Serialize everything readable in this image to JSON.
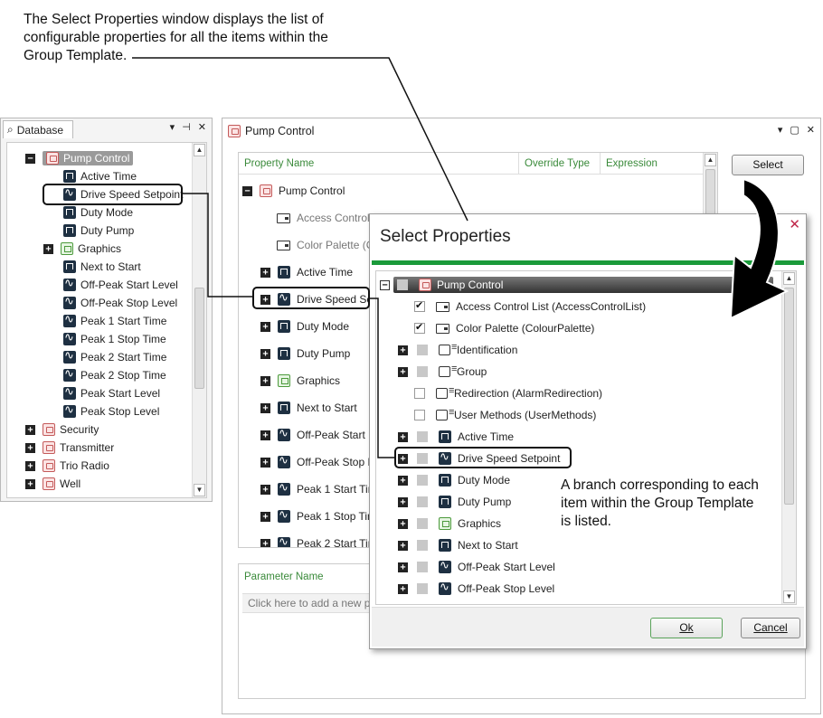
{
  "callouts": {
    "top": [
      "The Select Properties window displays the list of",
      "configurable properties for all the items within the",
      "Group Template."
    ],
    "branch": [
      "A branch corresponding to each",
      "item within the Group Template",
      "is listed."
    ]
  },
  "database_panel": {
    "tab_label": "Database",
    "controls": [
      "▾",
      "⊣",
      "✕"
    ],
    "tree": [
      {
        "label": "Pump Control",
        "icon": "folder",
        "level": 0,
        "expanded": true,
        "selected": true
      },
      {
        "label": "Active Time",
        "icon": "digital",
        "level": 1
      },
      {
        "label": "Drive Speed Setpoint",
        "icon": "analog",
        "level": 1
      },
      {
        "label": "Duty Mode",
        "icon": "digital",
        "level": 1
      },
      {
        "label": "Duty Pump",
        "icon": "digital",
        "level": 1
      },
      {
        "label": "Graphics",
        "icon": "folder-green",
        "level": 1,
        "collapsed": true
      },
      {
        "label": "Next to Start",
        "icon": "digital",
        "level": 1
      },
      {
        "label": "Off-Peak Start Level",
        "icon": "analog",
        "level": 1
      },
      {
        "label": "Off-Peak Stop Level",
        "icon": "analog",
        "level": 1
      },
      {
        "label": "Peak 1 Start Time",
        "icon": "analog",
        "level": 1
      },
      {
        "label": "Peak 1 Stop Time",
        "icon": "analog",
        "level": 1
      },
      {
        "label": "Peak 2 Start Time",
        "icon": "analog",
        "level": 1
      },
      {
        "label": "Peak 2 Stop Time",
        "icon": "analog",
        "level": 1
      },
      {
        "label": "Peak Start Level",
        "icon": "analog",
        "level": 1
      },
      {
        "label": "Peak Stop Level",
        "icon": "analog",
        "level": 1
      },
      {
        "label": "Security",
        "icon": "folder",
        "level": 0,
        "collapsed": true
      },
      {
        "label": "Transmitter",
        "icon": "folder",
        "level": 0,
        "collapsed": true
      },
      {
        "label": "Trio Radio",
        "icon": "folder",
        "level": 0,
        "collapsed": true
      },
      {
        "label": "Well",
        "icon": "folder",
        "level": 0,
        "collapsed": true
      }
    ]
  },
  "pump_control_window": {
    "title": "Pump Control",
    "controls": [
      "▾",
      "▢",
      "✕"
    ],
    "columns": [
      "Property Name",
      "Override Type",
      "Expression"
    ],
    "select_button": "Select",
    "tree": [
      {
        "label": "Pump Control",
        "icon": "folder",
        "level": 0,
        "expanded": true
      },
      {
        "label": "Access Control",
        "icon": "prop",
        "level": 1,
        "dim": true
      },
      {
        "label": "Color Palette (C",
        "icon": "prop",
        "level": 1,
        "dim": true
      },
      {
        "label": "Active Time",
        "icon": "digital",
        "level": 1,
        "collapsed": true
      },
      {
        "label": "Drive Speed Se",
        "icon": "analog",
        "level": 1,
        "collapsed": true
      },
      {
        "label": "Duty Mode",
        "icon": "digital",
        "level": 1,
        "collapsed": true
      },
      {
        "label": "Duty Pump",
        "icon": "digital",
        "level": 1,
        "collapsed": true
      },
      {
        "label": "Graphics",
        "icon": "folder-green",
        "level": 1,
        "collapsed": true
      },
      {
        "label": "Next to Start",
        "icon": "digital",
        "level": 1,
        "collapsed": true
      },
      {
        "label": "Off-Peak Start L",
        "icon": "analog",
        "level": 1,
        "collapsed": true
      },
      {
        "label": "Off-Peak Stop L",
        "icon": "analog",
        "level": 1,
        "collapsed": true
      },
      {
        "label": "Peak 1 Start Tin",
        "icon": "analog",
        "level": 1,
        "collapsed": true
      },
      {
        "label": "Peak 1 Stop Tin",
        "icon": "analog",
        "level": 1,
        "collapsed": true
      },
      {
        "label": "Peak 2 Start Tin",
        "icon": "analog",
        "level": 1,
        "collapsed": true
      }
    ],
    "param_header": "Parameter Name",
    "param_placeholder": "Click here to add a new p"
  },
  "select_properties_dialog": {
    "title": "Select Properties",
    "close_glyph": "✕",
    "ok_label": "Ok",
    "cancel_label": "Cancel",
    "tree": [
      {
        "label": "Pump Control",
        "icon": "folder",
        "check": "grey",
        "expander": "minus",
        "root": true
      },
      {
        "label": "Access Control List (AccessControlList)",
        "icon": "prop",
        "check": "on"
      },
      {
        "label": "Color Palette (ColourPalette)",
        "icon": "prop",
        "check": "on"
      },
      {
        "label": "Identification",
        "icon": "group",
        "check": "grey",
        "expander": "plus"
      },
      {
        "label": "Group",
        "icon": "group",
        "check": "grey",
        "expander": "plus"
      },
      {
        "label": "Redirection (AlarmRedirection)",
        "icon": "group",
        "check": "off"
      },
      {
        "label": "User Methods (UserMethods)",
        "icon": "group",
        "check": "off"
      },
      {
        "label": "Active Time",
        "icon": "digital",
        "check": "grey",
        "expander": "plus"
      },
      {
        "label": "Drive Speed Setpoint",
        "icon": "analog",
        "check": "grey",
        "expander": "plus"
      },
      {
        "label": "Duty Mode",
        "icon": "digital",
        "check": "grey",
        "expander": "plus"
      },
      {
        "label": "Duty Pump",
        "icon": "digital",
        "check": "grey",
        "expander": "plus"
      },
      {
        "label": "Graphics",
        "icon": "folder-green",
        "check": "grey",
        "expander": "plus"
      },
      {
        "label": "Next to Start",
        "icon": "digital",
        "check": "grey",
        "expander": "plus"
      },
      {
        "label": "Off-Peak Start Level",
        "icon": "analog",
        "check": "grey",
        "expander": "plus"
      },
      {
        "label": "Off-Peak Stop Level",
        "icon": "analog",
        "check": "grey",
        "expander": "plus"
      }
    ]
  },
  "colors": {
    "accent_green": "#1a9a3a",
    "header_green": "#3a8a3a",
    "close_red": "#c0284a",
    "icon_dark": "#1e3042"
  }
}
